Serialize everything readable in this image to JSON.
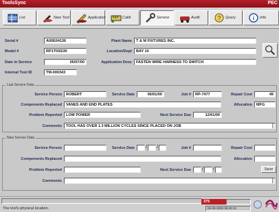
{
  "window": {
    "title": "ToolsSync",
    "logo_text": "PEC"
  },
  "toolbar": {
    "buttons": [
      {
        "label": "List",
        "icon": "grid-icon"
      },
      {
        "label": "New Tool",
        "icon": "pen-icon"
      },
      {
        "label": "Application",
        "icon": "pencil-icon"
      },
      {
        "label": "Calib",
        "icon": "ruler-icon"
      },
      {
        "label": "Service",
        "icon": "wrench-icon",
        "active": true
      },
      {
        "label": "Audit",
        "icon": "car-icon"
      },
      {
        "label": "Query",
        "icon": "query-icon"
      },
      {
        "label": "Info",
        "icon": "info-icon"
      }
    ]
  },
  "tool": {
    "serial_label": "Serial #",
    "serial": "A00E04136",
    "model_label": "Model #",
    "model": "RP1T0SS30",
    "dis_label": "Date in Service",
    "date_in_service": "05/07/00",
    "internal_label": "Internal Tool ID",
    "internal_id": "TM-000343",
    "plant_label": "Plant Name",
    "plant": "T & M FIXTURES INC.",
    "location_label": "Location/Dept",
    "location": "BAY 10",
    "appdesc_label": "Application Desc",
    "application": "FASTEN WIRE HARNESS TO SWITCH"
  },
  "last_service": {
    "section_title": "Last Service Data",
    "person_label": "Service Person",
    "person": "ROBERT",
    "date_label": "Service Date",
    "date": "06/01/00",
    "job_label": "Job #",
    "job": "RP-7477",
    "cost_label": "Repair Cost",
    "cost": "49",
    "components_label": "Components Replaced",
    "components": "VANES AND END PLATES",
    "allocation_label": "Allocation",
    "allocation": "MFG",
    "problem_label": "Problem Reported",
    "problem": "LOW POWER",
    "next_label": "Next Service Due",
    "next_due": "12/01/00",
    "comments_label": "Comments",
    "comments": "TOOL HAS OVER 1.3 MILLION CYCLES SINCE PLACED ON JOB"
  },
  "new_service": {
    "section_title": "New Service Data",
    "person_label": "Service Person",
    "date_label": "Service Date",
    "job_label": "Job #",
    "cost_label": "Repair Cost",
    "components_label": "Components Replaced",
    "allocation_label": "Allocation",
    "problem_label": "Problem Reported",
    "next_label": "Next Service Due",
    "comments_label": "Comments",
    "save_label": "Save"
  },
  "status": {
    "hint": "The tool's physical location.",
    "flag_text": "375",
    "clock": "06-09-2000 08:40:13"
  }
}
